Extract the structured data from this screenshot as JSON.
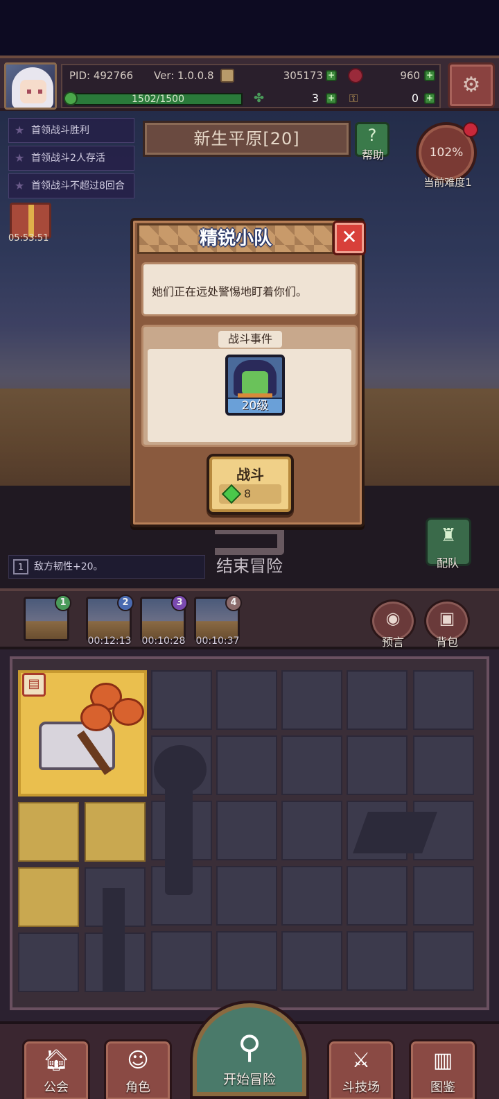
{
  "hud": {
    "pid": "PID: 492766",
    "version": "Ver: 1.0.0.8",
    "gold": "305173",
    "gems": "960",
    "stamina": "1502/1500",
    "stamina_fraction": 1.0,
    "clover": "3",
    "keys": "0",
    "coin_icon": "coin-icon",
    "gem_icon": "ruby-icon",
    "stamina_icon": "stamina-icon",
    "clover_icon": "clover-icon",
    "key_icon": "key-icon",
    "settings_icon": "gear-icon"
  },
  "objectives": [
    "首领战斗胜利",
    "首领战斗2人存活",
    "首领战斗不超过8回合"
  ],
  "gift_timer": "05:53:51",
  "stage": {
    "title": "新生平原[20]",
    "help_label": "帮助",
    "difficulty_percent": "102%",
    "difficulty_label": "当前难度1"
  },
  "modal": {
    "title": "精锐小队",
    "description": "她们正在远处警惕地盯着你们。",
    "event_title": "战斗事件",
    "enemy_level": "20级",
    "fight_label": "战斗",
    "fight_cost": "8"
  },
  "scene": {
    "end_adventure": "结束冒险",
    "formation_label": "配队",
    "buff_index": "1",
    "buff_text": "敌方韧性+20。"
  },
  "queue": {
    "slots": [
      {
        "badge": "1",
        "timer": "",
        "color": "#4a9a5a"
      },
      {
        "badge": "2",
        "timer": "00:12:13",
        "color": "#4a6ab0"
      },
      {
        "badge": "3",
        "timer": "00:10:28",
        "color": "#7a4ab0"
      },
      {
        "badge": "4",
        "timer": "00:10:37",
        "color": "#8a6a6a"
      }
    ],
    "prophecy_label": "预言",
    "backpack_label": "背包"
  },
  "nav": {
    "guild": "公会",
    "character": "角色",
    "start": "开始冒险",
    "arena": "斗技场",
    "codex": "图鉴"
  }
}
